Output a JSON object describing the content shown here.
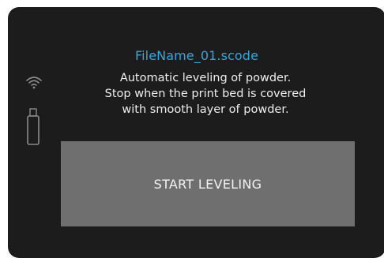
{
  "job": {
    "file_name": "FileName_01.scode",
    "message_lines": [
      "Automatic leveling of powder.",
      "Stop when the print bed is covered",
      "with smooth layer of powder."
    ]
  },
  "actions": {
    "start_label": "START LEVELING"
  },
  "status_icons": {
    "wifi": "wifi-icon",
    "usb": "usb-drive-icon"
  },
  "colors": {
    "background": "#1c1c1c",
    "file_name": "#3aa6d6",
    "text": "#eeeeee",
    "button": "#6f6f6f",
    "icons": "#8a8a8a"
  }
}
